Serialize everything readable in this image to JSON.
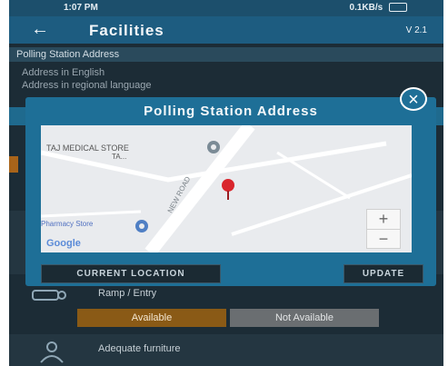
{
  "statusbar": {
    "time": "1:07 PM",
    "network": "0.1KB/s",
    "battery_icon": "battery-icon"
  },
  "appbar": {
    "title": "Facilities",
    "version": "V 2.1"
  },
  "section": {
    "title": "Polling Station Address",
    "address_english": "Address in English",
    "address_regional": "Address in regional language"
  },
  "modal": {
    "title": "Polling Station Address",
    "map": {
      "poi_top": "TAJ MEDICAL STORE",
      "poi_top_sub": "TA...",
      "road_label": "NEW ROAD",
      "poi_left": "Pharmacy Store",
      "brand": "Google",
      "zoom_in": "+",
      "zoom_out": "−"
    },
    "current_location": "CURRENT LOCATION",
    "update": "UPDATE"
  },
  "facility_rows": {
    "ramp_label": "Ramp / Entry",
    "available": "Available",
    "not_available": "Not Available",
    "furniture_label": "Adequate furniture"
  },
  "colors": {
    "appbar": "#1d5c80",
    "modal": "#1e6f97",
    "available": "#8a5a16",
    "not_available": "#6a6e71",
    "pin": "#d9262d"
  }
}
